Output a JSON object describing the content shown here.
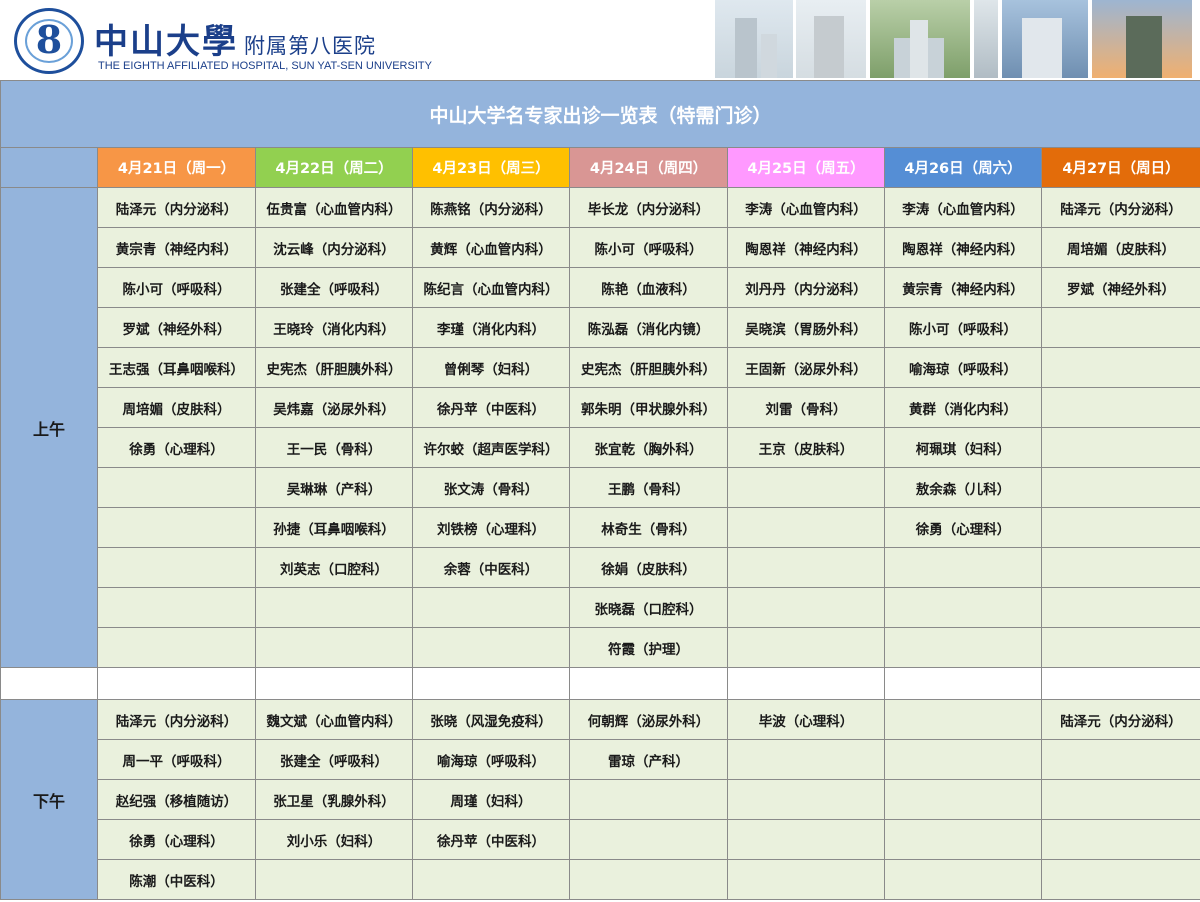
{
  "header": {
    "hospital_name_large": "中山大學",
    "hospital_name_small": "附属第八医院",
    "hospital_name_en": "THE EIGHTH AFFILIATED HOSPITAL, SUN YAT-SEN UNIVERSITY",
    "logo_icon": "hospital-logo-icon",
    "banner_photos": [
      "building-photo",
      "building-photo",
      "building-photo",
      "building-photo",
      "building-photo",
      "building-photo"
    ]
  },
  "schedule": {
    "title": "中山大学名专家出诊一览表（特需门诊）",
    "days": [
      {
        "label": "4月21日（周一）",
        "color": "#f79646"
      },
      {
        "label": "4月22日（周二）",
        "color": "#92d050"
      },
      {
        "label": "4月23日（周三）",
        "color": "#ffc000"
      },
      {
        "label": "4月24日（周四）",
        "color": "#d99694"
      },
      {
        "label": "4月25日（周五）",
        "color": "#ff99ff"
      },
      {
        "label": "4月26日（周六）",
        "color": "#558ed5"
      },
      {
        "label": "4月27日（周日）",
        "color": "#e36c0a"
      }
    ],
    "morning_label": "上午",
    "afternoon_label": "下午",
    "morning_rows": [
      [
        "陆泽元（内分泌科）",
        "伍贵富（心血管内科）",
        "陈燕铭（内分泌科）",
        "毕长龙（内分泌科）",
        "李涛（心血管内科）",
        "李涛（心血管内科）",
        "陆泽元（内分泌科）"
      ],
      [
        "黄宗青（神经内科）",
        "沈云峰（内分泌科）",
        "黄辉（心血管内科）",
        "陈小可（呼吸科）",
        "陶恩祥（神经内科）",
        "陶恩祥（神经内科）",
        "周培媚（皮肤科）"
      ],
      [
        "陈小可（呼吸科）",
        "张建全（呼吸科）",
        "陈纪言（心血管内科）",
        "陈艳（血液科）",
        "刘丹丹（内分泌科）",
        "黄宗青（神经内科）",
        "罗斌（神经外科）"
      ],
      [
        "罗斌（神经外科）",
        "王晓玲（消化内科）",
        "李瑾（消化内科）",
        "陈泓磊（消化内镜）",
        "吴晓滨（胃肠外科）",
        "陈小可（呼吸科）",
        ""
      ],
      [
        "王志强（耳鼻咽喉科）",
        "史宪杰（肝胆胰外科）",
        "曾俐琴（妇科）",
        "史宪杰（肝胆胰外科）",
        "王固新（泌尿外科）",
        "喻海琼（呼吸科）",
        ""
      ],
      [
        "周培媚（皮肤科）",
        "吴炜嘉（泌尿外科）",
        "徐丹苹（中医科）",
        "郭朱明（甲状腺外科）",
        "刘雷（骨科）",
        "黄群（消化内科）",
        ""
      ],
      [
        "徐勇（心理科）",
        "王一民（骨科）",
        "许尔蛟（超声医学科）",
        "张宜乾（胸外科）",
        "王京（皮肤科）",
        "柯珮琪（妇科）",
        ""
      ],
      [
        "",
        "吴琳琳（产科）",
        "张文涛（骨科）",
        "王鹏（骨科）",
        "",
        "敖余森（儿科）",
        ""
      ],
      [
        "",
        "孙捷（耳鼻咽喉科）",
        "刘铁榜（心理科）",
        "林奇生（骨科）",
        "",
        "徐勇（心理科）",
        ""
      ],
      [
        "",
        "刘英志（口腔科）",
        "余蓉（中医科）",
        "徐娟（皮肤科）",
        "",
        "",
        ""
      ],
      [
        "",
        "",
        "",
        "张晓磊（口腔科）",
        "",
        "",
        ""
      ],
      [
        "",
        "",
        "",
        "符霞（护理）",
        "",
        "",
        ""
      ]
    ],
    "afternoon_rows": [
      [
        "陆泽元（内分泌科）",
        "魏文斌（心血管内科）",
        "张晓（风湿免疫科）",
        "何朝辉（泌尿外科）",
        "毕波（心理科）",
        "",
        "陆泽元（内分泌科）"
      ],
      [
        "周一平（呼吸科）",
        "张建全（呼吸科）",
        "喻海琼（呼吸科）",
        "雷琼（产科）",
        "",
        "",
        ""
      ],
      [
        "赵纪强（移植随访）",
        "张卫星（乳腺外科）",
        "周瑾（妇科）",
        "",
        "",
        "",
        ""
      ],
      [
        "徐勇（心理科）",
        "刘小乐（妇科）",
        "徐丹苹（中医科）",
        "",
        "",
        "",
        ""
      ],
      [
        "陈潮（中医科）",
        "",
        "",
        "",
        "",
        "",
        ""
      ]
    ]
  }
}
